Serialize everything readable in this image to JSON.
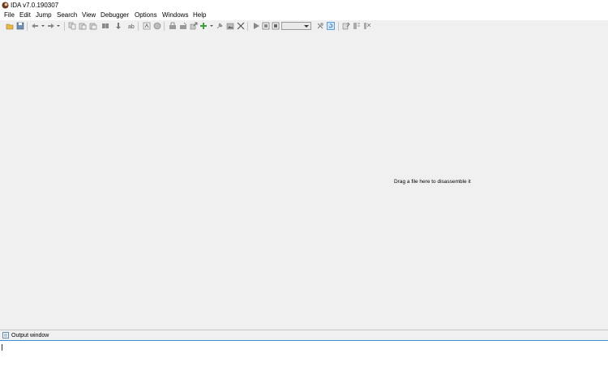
{
  "window": {
    "title": "IDA v7.0.190307"
  },
  "menu": [
    "File",
    "Edit",
    "Jump",
    "Search",
    "View",
    "Debugger",
    "Options",
    "Windows",
    "Help"
  ],
  "toolbar": {
    "icons": [
      "open-icon",
      "save-icon",
      "back-icon",
      "forward-icon",
      "copy-icon",
      "paste-icon",
      "paste2-icon",
      "patch-icon",
      "down-arrow-icon",
      "func-icon",
      "graph-icon",
      "globe-icon",
      "struct-icon",
      "enum-icon",
      "export-icon",
      "add-icon",
      "pin-icon",
      "image-icon",
      "close-icon",
      "play-icon",
      "pause-icon",
      "stop-icon",
      "debugger-select",
      "attach-icon",
      "refresh-icon",
      "text-icon",
      "bookmark-icon",
      "trace-icon"
    ],
    "debugger_select_value": ""
  },
  "main": {
    "drop_hint": "Drag a file here to disassemble it"
  },
  "output": {
    "title": "Output window",
    "value": ""
  }
}
